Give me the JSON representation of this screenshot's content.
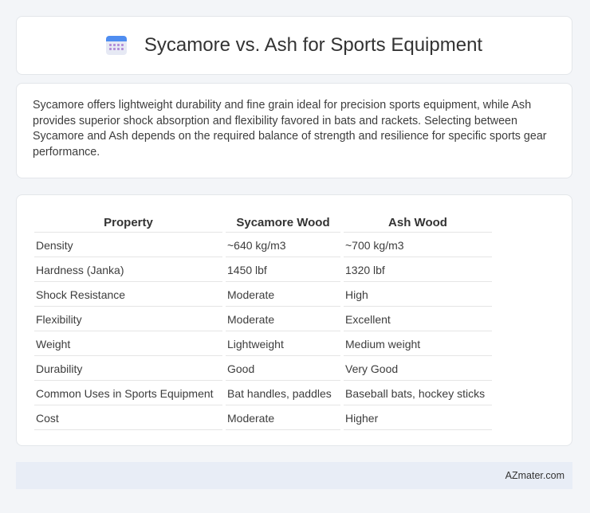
{
  "header": {
    "icon": "calendar-icon",
    "title": "Sycamore vs. Ash for Sports Equipment"
  },
  "description": "Sycamore offers lightweight durability and fine grain ideal for precision sports equipment, while Ash provides superior shock absorption and flexibility favored in bats and rackets. Selecting between Sycamore and Ash depends on the required balance of strength and resilience for specific sports gear performance.",
  "table": {
    "headers": [
      "Property",
      "Sycamore Wood",
      "Ash Wood"
    ],
    "rows": [
      [
        "Density",
        "~640 kg/m3",
        "~700 kg/m3"
      ],
      [
        "Hardness (Janka)",
        "1450 lbf",
        "1320 lbf"
      ],
      [
        "Shock Resistance",
        "Moderate",
        "High"
      ],
      [
        "Flexibility",
        "Moderate",
        "Excellent"
      ],
      [
        "Weight",
        "Lightweight",
        "Medium weight"
      ],
      [
        "Durability",
        "Good",
        "Very Good"
      ],
      [
        "Common Uses in Sports Equipment",
        "Bat handles, paddles",
        "Baseball bats, hockey sticks"
      ],
      [
        "Cost",
        "Moderate",
        "Higher"
      ]
    ]
  },
  "footer": {
    "site": "AZmater.com"
  }
}
